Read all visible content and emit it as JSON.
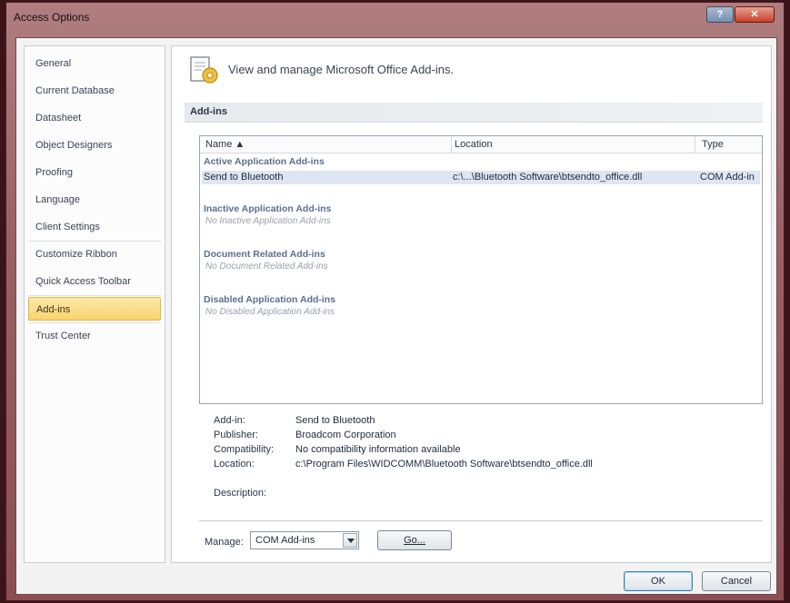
{
  "window": {
    "title": "Access Options",
    "help_label": "?",
    "close_label": "✕"
  },
  "nav": {
    "items": [
      {
        "label": "General"
      },
      {
        "label": "Current Database"
      },
      {
        "label": "Datasheet"
      },
      {
        "label": "Object Designers"
      },
      {
        "label": "Proofing"
      },
      {
        "label": "Language"
      },
      {
        "label": "Client Settings"
      },
      {
        "label": "Customize Ribbon"
      },
      {
        "label": "Quick Access Toolbar"
      },
      {
        "label": "Add-ins",
        "selected": true
      },
      {
        "label": "Trust Center"
      }
    ]
  },
  "header": {
    "text": "View and manage Microsoft Office Add-ins."
  },
  "section": {
    "title": "Add-ins"
  },
  "list": {
    "columns": [
      "Name ▲",
      "Location",
      "Type"
    ],
    "groups": [
      {
        "title": "Active Application Add-ins",
        "rows": [
          {
            "name": "Send to Bluetooth",
            "location": "c:\\...\\Bluetooth Software\\btsendto_office.dll",
            "type": "COM Add-in"
          }
        ]
      },
      {
        "title": "Inactive Application Add-ins",
        "empty": "No Inactive Application Add-ins"
      },
      {
        "title": "Document Related Add-ins",
        "empty": "No Document Related Add-ins"
      },
      {
        "title": "Disabled Application Add-ins",
        "empty": "No Disabled Application Add-ins"
      }
    ]
  },
  "details": {
    "addin_label": "Add-in:",
    "addin_value": "Send to Bluetooth",
    "publisher_label": "Publisher:",
    "publisher_value": "Broadcom Corporation",
    "compat_label": "Compatibility:",
    "compat_value": "No compatibility information available",
    "location_label": "Location:",
    "location_value": "c:\\Program Files\\WIDCOMM\\Bluetooth Software\\btsendto_office.dll",
    "description_label": "Description:"
  },
  "manage": {
    "label": "Manage:",
    "selected": "COM Add-ins",
    "go_label": "Go..."
  },
  "footer": {
    "ok_label": "OK",
    "cancel_label": "Cancel"
  }
}
